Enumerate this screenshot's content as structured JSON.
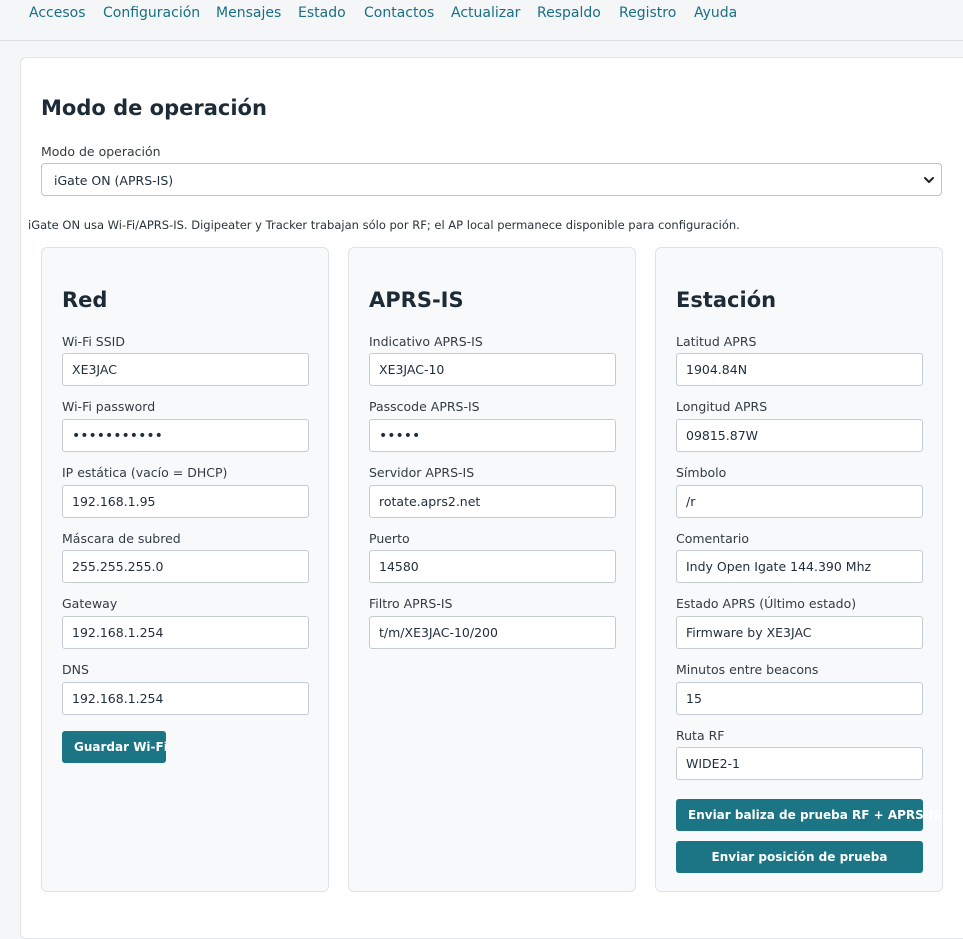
{
  "nav": {
    "items": [
      "Accesos",
      "Configuración",
      "Mensajes",
      "Estado",
      "Contactos",
      "Actualizar",
      "Respaldo",
      "Registro",
      "Ayuda"
    ]
  },
  "page": {
    "title": "Modo de operación",
    "mode_label": "Modo de operación",
    "mode_value": "iGate ON (APRS-IS)",
    "note": "iGate ON usa Wi-Fi/APRS-IS. Digipeater y Tracker trabajan sólo por RF; el AP local permanece disponible para configuración."
  },
  "red": {
    "title": "Red",
    "ssid_label": "Wi-Fi SSID",
    "ssid_value": "XE3JAC",
    "password_label": "Wi-Fi password",
    "password_value": "ABCDEFGHIJK",
    "ip_label": "IP estática (vacío = DHCP)",
    "ip_value": "192.168.1.95",
    "mask_label": "Máscara de subred",
    "mask_value": "255.255.255.0",
    "gateway_label": "Gateway",
    "gateway_value": "192.168.1.254",
    "dns_label": "DNS",
    "dns_value": "192.168.1.254",
    "save_button": "Guardar Wi-Fi"
  },
  "aprsis": {
    "title": "APRS-IS",
    "callsign_label": "Indicativo APRS-IS",
    "callsign_value": "XE3JAC-10",
    "passcode_label": "Passcode APRS-IS",
    "passcode_value": "12345",
    "server_label": "Servidor APRS-IS",
    "server_value": "rotate.aprs2.net",
    "port_label": "Puerto",
    "port_value": "14580",
    "filter_label": "Filtro APRS-IS",
    "filter_value": "t/m/XE3JAC-10/200"
  },
  "station": {
    "title": "Estación",
    "lat_label": "Latitud APRS",
    "lat_value": "1904.84N",
    "lon_label": "Longitud APRS",
    "lon_value": "09815.87W",
    "symbol_label": "Símbolo",
    "symbol_value": "/r",
    "comment_label": "Comentario",
    "comment_value": "Indy Open Igate 144.390 Mhz",
    "status_label": "Estado APRS (Último estado)",
    "status_value": "Firmware by XE3JAC",
    "minutes_label": "Minutos entre beacons",
    "minutes_value": "15",
    "path_label": "Ruta RF",
    "path_value": "WIDE2-1",
    "beacon_button": "Enviar baliza de prueba RF + APRS-IS",
    "position_button": "Enviar posición de prueba"
  },
  "colors": {
    "link": "#1a6f86",
    "button": "#1b7585",
    "heading": "#1c2b36"
  }
}
